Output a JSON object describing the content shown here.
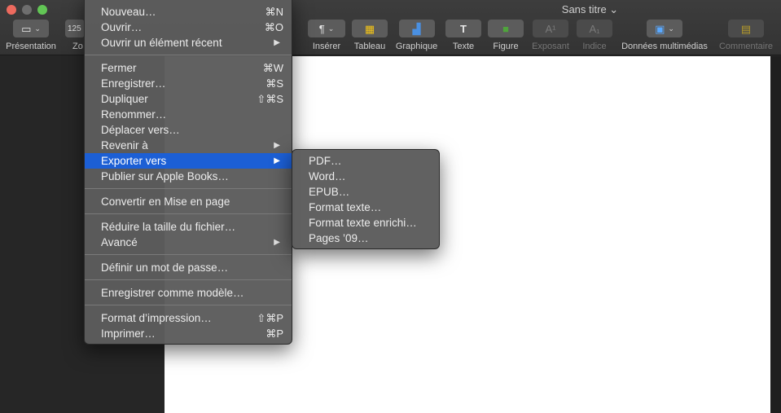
{
  "window": {
    "title": "Sans titre ⌄"
  },
  "toolbar": {
    "presentation_label": "Présentation",
    "zoom_value": "125",
    "zoom_label": "Zo",
    "inserer_label": "Insérer",
    "tableau_label": "Tableau",
    "graphique_label": "Graphique",
    "texte_label": "Texte",
    "figure_label": "Figure",
    "exposant_label": "Exposant",
    "indice_label": "Indice",
    "multimedia_label": "Données multimédias",
    "commentaire_label": "Commentaire"
  },
  "file_menu": {
    "items": [
      {
        "label": "Nouveau…",
        "shortcut": "⌘N"
      },
      {
        "label": "Ouvrir…",
        "shortcut": "⌘O"
      },
      {
        "label": "Ouvrir un élément récent",
        "arrow": "▶"
      },
      {
        "label": "Fermer",
        "shortcut": "⌘W"
      },
      {
        "label": "Enregistrer…",
        "shortcut": "⌘S"
      },
      {
        "label": "Dupliquer",
        "shortcut": "⇧⌘S"
      },
      {
        "label": "Renommer…"
      },
      {
        "label": "Déplacer vers…"
      },
      {
        "label": "Revenir à",
        "arrow": "▶"
      },
      {
        "label": "Exporter vers",
        "arrow": "▶"
      },
      {
        "label": "Publier sur Apple Books…"
      },
      {
        "label": "Convertir en Mise en page"
      },
      {
        "label": "Réduire la taille du fichier…"
      },
      {
        "label": "Avancé",
        "arrow": "▶"
      },
      {
        "label": "Définir un mot de passe…"
      },
      {
        "label": "Enregistrer comme modèle…"
      },
      {
        "label": "Format d’impression…",
        "shortcut": "⇧⌘P"
      },
      {
        "label": "Imprimer…",
        "shortcut": "⌘P"
      }
    ]
  },
  "export_menu": {
    "items": [
      {
        "label": "PDF…"
      },
      {
        "label": "Word…"
      },
      {
        "label": "EPUB…"
      },
      {
        "label": "Format texte…"
      },
      {
        "label": "Format texte enrichi…"
      },
      {
        "label": "Pages ’09…"
      }
    ]
  },
  "colors": {
    "highlight": "#1c5fd5",
    "menu_bg": "#5c5c5c",
    "page": "#ffffff"
  }
}
